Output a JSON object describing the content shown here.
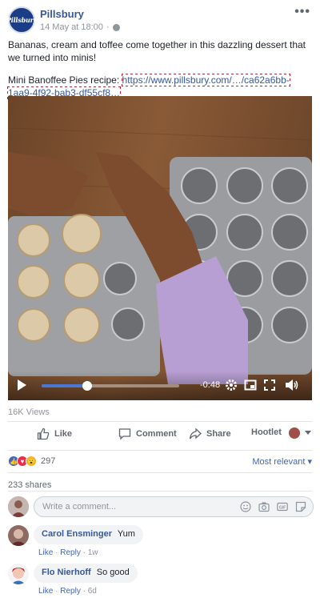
{
  "post": {
    "page_name": "Pillsbury",
    "logo_text": "Pillsbury",
    "timestamp": "14 May at 18:00",
    "separator": "·",
    "more": "•••",
    "text": "Bananas, cream and toffee come together in this dazzling dessert that we turned into minis!",
    "recipe_prefix": "Mini Banoffee Pies recipe:",
    "recipe_link": "https://www.pillsbury.com/…/ca62a6bb-1aa9-4f92-bab3-df55cf8…"
  },
  "video": {
    "progress": 0.33,
    "time_remaining": "-0:48"
  },
  "stats": {
    "views": "16K Views",
    "reaction_count": "297",
    "shares": "233 shares",
    "sort_label": "Most relevant"
  },
  "actions": {
    "like": "Like",
    "comment": "Comment",
    "share": "Share",
    "hootlet": "Hootlet"
  },
  "composer": {
    "placeholder": "Write a comment..."
  },
  "comments": [
    {
      "author": "Carol Ensminger",
      "text": "Yum",
      "like": "Like",
      "reply": "Reply",
      "time": "1w",
      "sep": "·"
    },
    {
      "author": "Flo Nierhoff",
      "text": "So good",
      "like": "Like",
      "reply": "Reply",
      "time": "6d",
      "sep": "·"
    }
  ],
  "colors": {
    "link": "#365899",
    "accent": "#4267b2",
    "scrubber": "#4a76d4"
  }
}
